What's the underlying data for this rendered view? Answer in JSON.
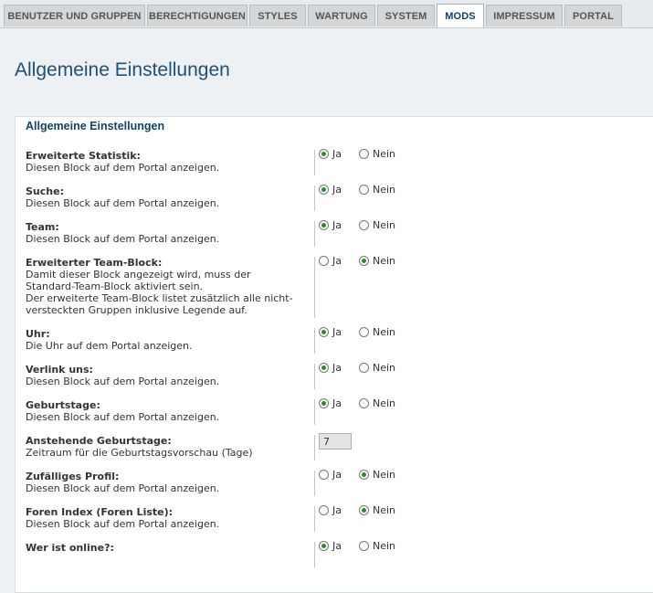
{
  "tabs": [
    {
      "label": "BENUTZER UND GRUPPEN"
    },
    {
      "label": "BERECHTIGUNGEN"
    },
    {
      "label": "STYLES"
    },
    {
      "label": "WARTUNG"
    },
    {
      "label": "SYSTEM"
    },
    {
      "label": "MODS",
      "active": true
    },
    {
      "label": "IMPRESSUM"
    },
    {
      "label": "PORTAL"
    }
  ],
  "page_title": "Allgemeine Einstellungen",
  "fieldset_legend": "Allgemeine Einstellungen",
  "option_labels": {
    "yes": "Ja",
    "no": "Nein"
  },
  "settings": [
    {
      "title": "Erweiterte Statistik:",
      "desc": "Diesen Block auf dem Portal anzeigen.",
      "value": "Ja"
    },
    {
      "title": "Suche:",
      "desc": "Diesen Block auf dem Portal anzeigen.",
      "value": "Ja"
    },
    {
      "title": "Team:",
      "desc": "Diesen Block auf dem Portal anzeigen.",
      "value": "Ja"
    },
    {
      "title": "Erweiterter Team-Block:",
      "desc_lines": [
        "Damit dieser Block angezeigt wird, muss der",
        "Standard-Team-Block aktiviert sein.",
        "Der erweiterte Team-Block listet zusätzlich alle nicht-",
        "versteckten Gruppen inklusive Legende auf."
      ],
      "value": "Nein"
    },
    {
      "title": "Uhr:",
      "desc": "Die Uhr auf dem Portal anzeigen.",
      "value": "Ja"
    },
    {
      "title": "Verlink uns:",
      "desc": "Diesen Block auf dem Portal anzeigen.",
      "value": "Ja"
    },
    {
      "title": "Geburtstage:",
      "desc": "Diesen Block auf dem Portal anzeigen.",
      "value": "Ja"
    },
    {
      "title": "Anstehende Geburtstage:",
      "desc": "Zeitraum für die Geburtstagsvorschau (Tage)",
      "input_value": "7"
    },
    {
      "title": "Zufälliges Profil:",
      "desc": "Diesen Block auf dem Portal anzeigen.",
      "value": "Nein"
    },
    {
      "title": "Foren Index (Foren Liste):",
      "desc": "Diesen Block auf dem Portal anzeigen.",
      "value": "Nein"
    },
    {
      "title": "Wer ist online?:",
      "desc": "",
      "value": "Ja"
    }
  ]
}
